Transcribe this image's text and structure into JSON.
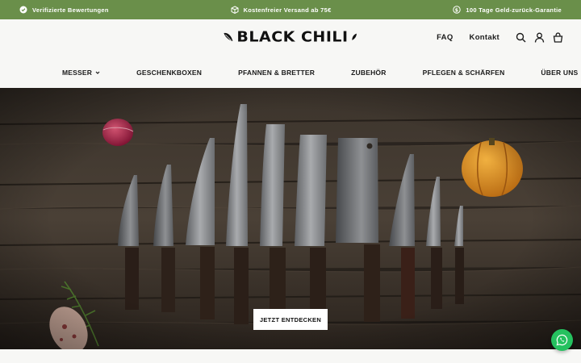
{
  "topbar": {
    "items": [
      {
        "label": "Verifizierte Bewertungen",
        "icon": "verified-badge-icon"
      },
      {
        "label": "Kostenfreier Versand ab 75€",
        "icon": "shipping-box-icon"
      },
      {
        "label": "100 Tage Geld-zurück-Garantie",
        "icon": "money-back-icon"
      }
    ],
    "bg_color": "#6a8f4a"
  },
  "header": {
    "logo_text": "BLACK CHILI",
    "faq_label": "FAQ",
    "contact_label": "Kontakt",
    "icons": [
      "search-icon",
      "account-icon",
      "cart-icon"
    ]
  },
  "nav": {
    "items": [
      {
        "label": "MESSER",
        "has_dropdown": true
      },
      {
        "label": "GESCHENKBOXEN",
        "has_dropdown": false
      },
      {
        "label": "PFANNEN & BRETTER",
        "has_dropdown": false
      },
      {
        "label": "ZUBEHÖR",
        "has_dropdown": false
      },
      {
        "label": "PFLEGEN & SCHÄRFEN",
        "has_dropdown": false
      },
      {
        "label": "ÜBER UNS",
        "has_dropdown": true
      }
    ]
  },
  "hero": {
    "cta_label": "JETZT ENTDECKEN"
  },
  "whatsapp": {
    "icon": "whatsapp-icon",
    "color": "#25c15f"
  }
}
